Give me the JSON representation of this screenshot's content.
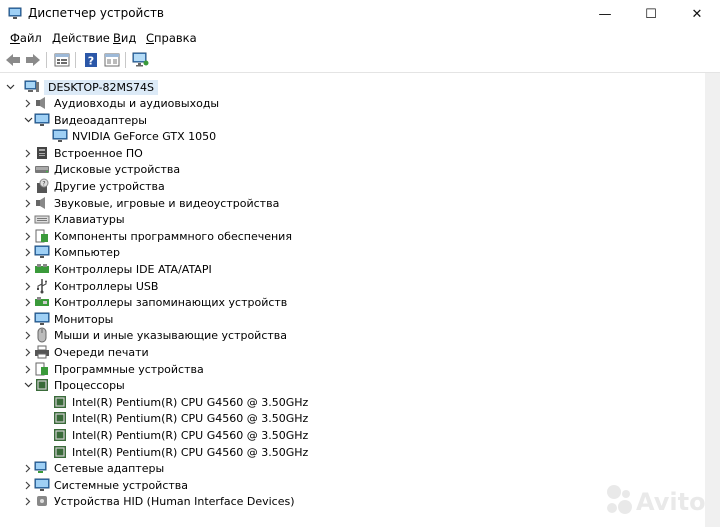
{
  "window": {
    "title": "Диспетчер устройств",
    "controls": [
      "—",
      "☐",
      "✕"
    ]
  },
  "menu": [
    {
      "label": "Файл",
      "key": "Ф",
      "rest": "айл"
    },
    {
      "label": "Действие",
      "key": "Д",
      "rest": "ействие"
    },
    {
      "label": "Вид",
      "key": "В",
      "rest": "ид"
    },
    {
      "label": "Справка",
      "key": "С",
      "rest": "правка"
    }
  ],
  "toolbar": {
    "buttons": [
      "back-icon",
      "forward-icon",
      "properties-icon",
      "help-icon",
      "view-icon",
      "scan-icon"
    ]
  },
  "tree": {
    "root": "DESKTOP-82MS74S",
    "items": [
      {
        "label": "Аудиовходы и аудиовыходы",
        "level": 1,
        "state": "collapsed",
        "icon": "audio-icon"
      },
      {
        "label": "Видеоадаптеры",
        "level": 1,
        "state": "expanded",
        "icon": "display-adapter-icon"
      },
      {
        "label": "NVIDIA GeForce GTX 1050",
        "level": 2,
        "state": "leaf",
        "icon": "display-adapter-icon"
      },
      {
        "label": "Встроенное ПО",
        "level": 1,
        "state": "collapsed",
        "icon": "firmware-icon"
      },
      {
        "label": "Дисковые устройства",
        "level": 1,
        "state": "collapsed",
        "icon": "disk-icon"
      },
      {
        "label": "Другие устройства",
        "level": 1,
        "state": "collapsed",
        "icon": "unknown-device-icon"
      },
      {
        "label": "Звуковые, игровые и видеоустройства",
        "level": 1,
        "state": "collapsed",
        "icon": "speaker-icon"
      },
      {
        "label": "Клавиатуры",
        "level": 1,
        "state": "collapsed",
        "icon": "keyboard-icon"
      },
      {
        "label": "Компоненты программного обеспечения",
        "level": 1,
        "state": "collapsed",
        "icon": "software-component-icon"
      },
      {
        "label": "Компьютер",
        "level": 1,
        "state": "collapsed",
        "icon": "computer-icon"
      },
      {
        "label": "Контроллеры IDE ATA/ATAPI",
        "level": 1,
        "state": "collapsed",
        "icon": "ide-controller-icon"
      },
      {
        "label": "Контроллеры USB",
        "level": 1,
        "state": "collapsed",
        "icon": "usb-icon"
      },
      {
        "label": "Контроллеры запоминающих устройств",
        "level": 1,
        "state": "collapsed",
        "icon": "storage-controller-icon"
      },
      {
        "label": "Мониторы",
        "level": 1,
        "state": "collapsed",
        "icon": "monitor-icon"
      },
      {
        "label": "Мыши и иные указывающие устройства",
        "level": 1,
        "state": "collapsed",
        "icon": "mouse-icon"
      },
      {
        "label": "Очереди печати",
        "level": 1,
        "state": "collapsed",
        "icon": "printer-icon"
      },
      {
        "label": "Программные устройства",
        "level": 1,
        "state": "collapsed",
        "icon": "software-device-icon"
      },
      {
        "label": "Процессоры",
        "level": 1,
        "state": "expanded",
        "icon": "cpu-icon"
      },
      {
        "label": "Intel(R) Pentium(R) CPU G4560 @ 3.50GHz",
        "level": 2,
        "state": "leaf",
        "icon": "cpu-icon"
      },
      {
        "label": "Intel(R) Pentium(R) CPU G4560 @ 3.50GHz",
        "level": 2,
        "state": "leaf",
        "icon": "cpu-icon"
      },
      {
        "label": "Intel(R) Pentium(R) CPU G4560 @ 3.50GHz",
        "level": 2,
        "state": "leaf",
        "icon": "cpu-icon"
      },
      {
        "label": "Intel(R) Pentium(R) CPU G4560 @ 3.50GHz",
        "level": 2,
        "state": "leaf",
        "icon": "cpu-icon"
      },
      {
        "label": "Сетевые адаптеры",
        "level": 1,
        "state": "collapsed",
        "icon": "network-adapter-icon"
      },
      {
        "label": "Системные устройства",
        "level": 1,
        "state": "collapsed",
        "icon": "system-device-icon"
      },
      {
        "label": "Устройства HID (Human Interface Devices)",
        "level": 1,
        "state": "collapsed",
        "icon": "hid-icon"
      }
    ]
  },
  "watermark": {
    "text": "Avito",
    "icon": "avito-logo-icon"
  }
}
